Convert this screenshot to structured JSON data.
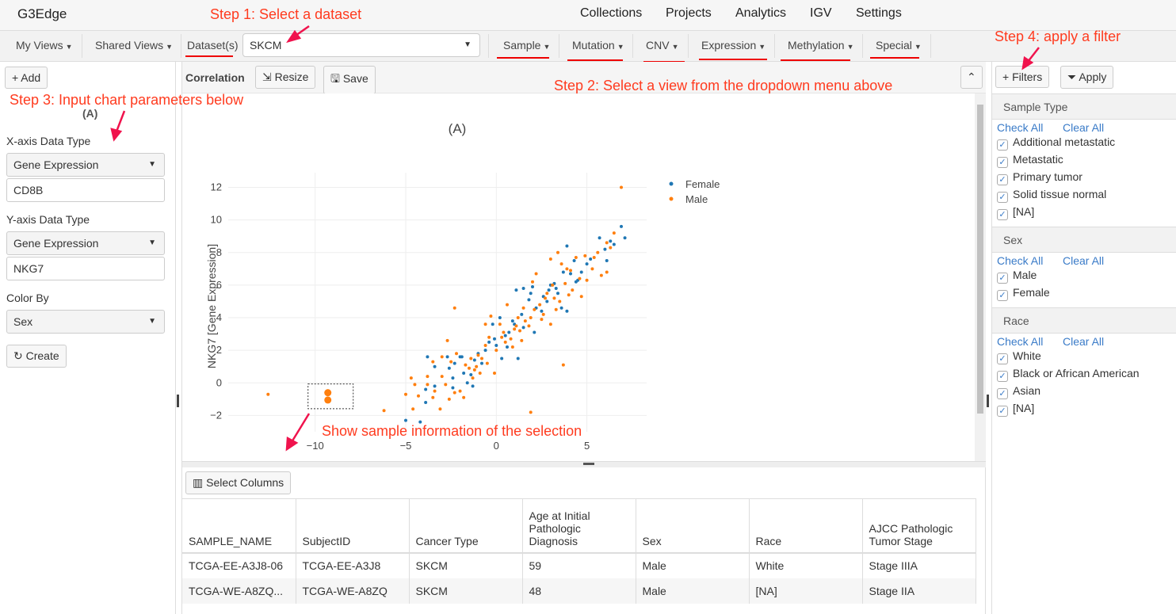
{
  "app": {
    "title": "G3Edge",
    "nav": [
      "Collections",
      "Projects",
      "Analytics",
      "IGV",
      "Settings"
    ]
  },
  "toolbar": {
    "my_views": "My Views",
    "shared_views": "Shared Views",
    "dataset_label": "Dataset(s)",
    "dataset_value": "SKCM",
    "menus": [
      "Sample",
      "Mutation",
      "CNV",
      "Expression",
      "Methylation",
      "Special"
    ]
  },
  "left": {
    "add": "Add",
    "chart_label": "(A)",
    "x_type_label": "X-axis Data Type",
    "x_type": "Gene Expression",
    "x_gene": "CD8B",
    "y_type_label": "Y-axis Data Type",
    "y_type": "Gene Expression",
    "y_gene": "NKG7",
    "color_label": "Color By",
    "color_value": "Sex",
    "create": "Create"
  },
  "center": {
    "title": "Correlation",
    "resize": "Resize",
    "save": "Save",
    "select_columns": "Select Columns"
  },
  "annotations": {
    "step1": "Step 1: Select a dataset",
    "step2": "Step 2: Select a view from the dropdown menu above",
    "step3": "Step 3: Input chart parameters below",
    "step4": "Step 4: apply a filter",
    "selection": "Show sample information of the selection"
  },
  "colors": {
    "female": "#1f77b4",
    "male": "#ff7f0e",
    "annotation": "#ff3b1f",
    "link": "#3a7bc8"
  },
  "filters": {
    "add": "Filters",
    "apply": "Apply",
    "check_all": "Check All",
    "clear_all": "Clear All",
    "groups": [
      {
        "title": "Sample Type",
        "items": [
          "Additional metastatic",
          "Metastatic",
          "Primary tumor",
          "Solid tissue normal",
          "[NA]"
        ]
      },
      {
        "title": "Sex",
        "items": [
          "Male",
          "Female"
        ]
      },
      {
        "title": "Race",
        "items": [
          "White",
          "Black or African American",
          "Asian",
          "[NA]"
        ]
      }
    ]
  },
  "table": {
    "columns": [
      "SAMPLE_NAME",
      "SubjectID",
      "Cancer Type",
      "Age at Initial Pathologic Diagnosis",
      "Sex",
      "Race",
      "AJCC Pathologic Tumor Stage"
    ],
    "rows": [
      [
        "TCGA-EE-A3J8-06",
        "TCGA-EE-A3J8",
        "SKCM",
        "59",
        "Male",
        "White",
        "Stage IIIA"
      ],
      [
        "TCGA-WE-A8ZQ...",
        "TCGA-WE-A8ZQ",
        "SKCM",
        "48",
        "Male",
        "[NA]",
        "Stage IIA"
      ]
    ]
  },
  "chart_data": {
    "type": "scatter",
    "title": "(A)",
    "xlabel": "",
    "ylabel": "NKG7 [Gene Expression]",
    "xlim": [
      -14.8,
      8.3
    ],
    "ylim": [
      -3,
      12.9
    ],
    "xticks": [
      -10,
      -5,
      0,
      5
    ],
    "yticks": [
      -2,
      0,
      2,
      4,
      6,
      8,
      10,
      12
    ],
    "grid": true,
    "legend": "top-right",
    "series": [
      {
        "name": "Female",
        "color": "#1f77b4",
        "points": [
          [
            -5,
            -2.3
          ],
          [
            -4.2,
            -2.4
          ],
          [
            -3.9,
            -1.2
          ],
          [
            -3.8,
            1.6
          ],
          [
            -3.9,
            -0.4
          ],
          [
            -3.4,
            -0.2
          ],
          [
            -3.4,
            1
          ],
          [
            -2.7,
            1.6
          ],
          [
            -2.6,
            0.9
          ],
          [
            -2.4,
            0.3
          ],
          [
            -2.3,
            1.2
          ],
          [
            -2,
            1.6
          ],
          [
            -1.9,
            1.6
          ],
          [
            -1.8,
            0.6
          ],
          [
            -1.6,
            0
          ],
          [
            -1.4,
            0.5
          ],
          [
            -1.3,
            -0.2
          ],
          [
            -1.2,
            1.4
          ],
          [
            -1,
            1.8
          ],
          [
            -0.8,
            1.2
          ],
          [
            -0.6,
            2
          ],
          [
            -0.4,
            2.5
          ],
          [
            -0.2,
            3.6
          ],
          [
            0,
            2.3
          ],
          [
            0.2,
            4
          ],
          [
            0.3,
            1.5
          ],
          [
            0.5,
            2.9
          ],
          [
            0.7,
            3.1
          ],
          [
            0.9,
            3.8
          ],
          [
            1.1,
            5.7
          ],
          [
            1.2,
            1.5
          ],
          [
            1.4,
            4.2
          ],
          [
            1.5,
            3.4
          ],
          [
            1.5,
            5.8
          ],
          [
            1.8,
            5.1
          ],
          [
            1.9,
            5.5
          ],
          [
            2.1,
            3.1
          ],
          [
            2.2,
            4.6
          ],
          [
            2.5,
            4.4
          ],
          [
            2.6,
            5.3
          ],
          [
            2.8,
            5
          ],
          [
            3,
            6
          ],
          [
            3.2,
            6.1
          ],
          [
            3.4,
            5.5
          ],
          [
            3.6,
            4.6
          ],
          [
            3.7,
            6.8
          ],
          [
            3.9,
            8.4
          ],
          [
            3.9,
            4.4
          ],
          [
            4.1,
            6.7
          ],
          [
            4.3,
            7.5
          ],
          [
            4.4,
            6.2
          ],
          [
            4.7,
            6.8
          ],
          [
            5,
            7.3
          ],
          [
            5.2,
            7.6
          ],
          [
            5.7,
            8.9
          ],
          [
            6,
            8.2
          ],
          [
            6.1,
            7.5
          ],
          [
            6.3,
            8.7
          ],
          [
            6.5,
            8.5
          ],
          [
            6.9,
            9.6
          ],
          [
            7.1,
            8.9
          ],
          [
            2,
            5.9
          ],
          [
            1,
            3.6
          ],
          [
            0.6,
            2.2
          ],
          [
            -0.1,
            2.7
          ],
          [
            2.9,
            5.7
          ],
          [
            3.3,
            5.8
          ],
          [
            4.5,
            6.3
          ],
          [
            -2.4,
            -0.3
          ]
        ]
      },
      {
        "name": "Male",
        "color": "#ff7f0e",
        "selected": [
          1,
          2
        ],
        "points": [
          [
            -12.6,
            -0.7
          ],
          [
            -9.3,
            -0.6
          ],
          [
            -9.3,
            -1.05
          ],
          [
            -6.2,
            -1.7
          ],
          [
            -5,
            -0.7
          ],
          [
            -4.7,
            0.3
          ],
          [
            -4.6,
            -1.6
          ],
          [
            -4.5,
            -0.1
          ],
          [
            -4.3,
            -0.8
          ],
          [
            -3.8,
            -0.1
          ],
          [
            -3.8,
            0.4
          ],
          [
            -3.5,
            -0.9
          ],
          [
            -3.5,
            1.3
          ],
          [
            -3.4,
            -0.5
          ],
          [
            -3.1,
            -1.6
          ],
          [
            -3,
            0.4
          ],
          [
            -3,
            1.6
          ],
          [
            -2.8,
            -0.1
          ],
          [
            -2.7,
            2.6
          ],
          [
            -2.6,
            -1
          ],
          [
            -2.5,
            1.3
          ],
          [
            -2.3,
            4.6
          ],
          [
            -2.3,
            -0.6
          ],
          [
            -2.2,
            1.8
          ],
          [
            -2,
            -0.5
          ],
          [
            -1.8,
            -0.9
          ],
          [
            -1.7,
            1.1
          ],
          [
            -1.5,
            0.9
          ],
          [
            -1.4,
            1.5
          ],
          [
            -1.2,
            0.8
          ],
          [
            -1.1,
            1
          ],
          [
            -1,
            1.7
          ],
          [
            -0.9,
            0.6
          ],
          [
            -0.8,
            1.5
          ],
          [
            -0.6,
            2.3
          ],
          [
            -0.5,
            1.2
          ],
          [
            -0.4,
            2.8
          ],
          [
            -0.3,
            4.1
          ],
          [
            -0.1,
            0.6
          ],
          [
            0,
            2
          ],
          [
            0.2,
            3.6
          ],
          [
            0.3,
            2.8
          ],
          [
            0.5,
            2.5
          ],
          [
            0.6,
            4.8
          ],
          [
            0.8,
            2.7
          ],
          [
            1,
            3.3
          ],
          [
            1.1,
            3.5
          ],
          [
            1.2,
            4
          ],
          [
            1.3,
            3.2
          ],
          [
            1.5,
            4.6
          ],
          [
            1.6,
            3.8
          ],
          [
            1.8,
            3.5
          ],
          [
            1.9,
            4
          ],
          [
            2,
            6.2
          ],
          [
            2.1,
            4.5
          ],
          [
            2.2,
            6.7
          ],
          [
            2.4,
            4.8
          ],
          [
            2.5,
            3.9
          ],
          [
            2.6,
            4.2
          ],
          [
            2.8,
            5.5
          ],
          [
            3,
            3.6
          ],
          [
            3,
            7.6
          ],
          [
            3.2,
            5.2
          ],
          [
            3.3,
            4.5
          ],
          [
            3.4,
            8
          ],
          [
            3.5,
            5
          ],
          [
            3.6,
            7.3
          ],
          [
            3.7,
            1.1
          ],
          [
            3.8,
            6.1
          ],
          [
            3.9,
            7
          ],
          [
            4,
            5.4
          ],
          [
            4.2,
            5.7
          ],
          [
            4.4,
            7.7
          ],
          [
            4.6,
            6.4
          ],
          [
            4.7,
            5.3
          ],
          [
            4.9,
            7.8
          ],
          [
            5,
            6.3
          ],
          [
            5.3,
            7
          ],
          [
            5.6,
            8
          ],
          [
            5.8,
            6.6
          ],
          [
            6.1,
            6.8
          ],
          [
            6.1,
            8.6
          ],
          [
            6.3,
            8.3
          ],
          [
            6.5,
            9.2
          ],
          [
            6.9,
            12
          ],
          [
            1.9,
            -1.8
          ],
          [
            -0.6,
            3.6
          ],
          [
            1.4,
            2.6
          ],
          [
            2.7,
            5.2
          ],
          [
            3.1,
            6
          ],
          [
            4.1,
            6.9
          ],
          [
            5.4,
            7.7
          ],
          [
            0.9,
            2.2
          ],
          [
            -1.3,
            0.3
          ],
          [
            0.4,
            3.1
          ]
        ]
      }
    ]
  }
}
